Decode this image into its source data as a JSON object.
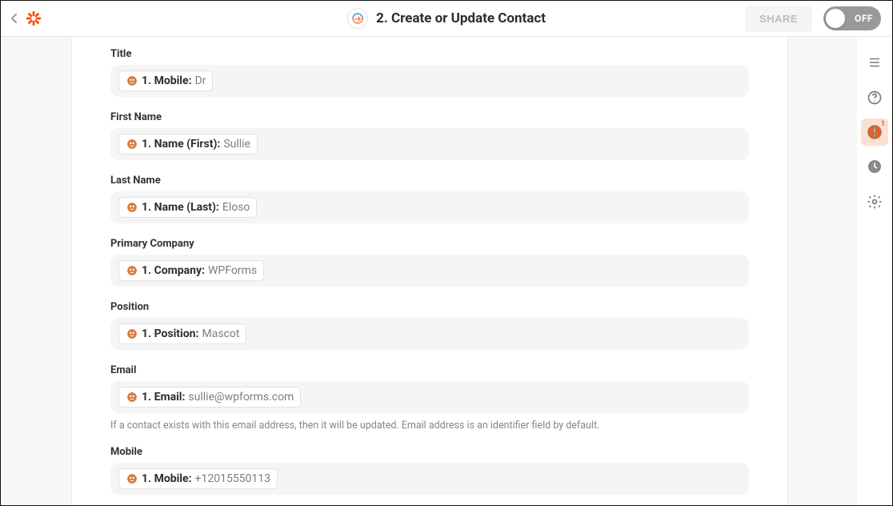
{
  "header": {
    "title": "2. Create or Update Contact",
    "share_label": "SHARE",
    "toggle_label": "OFF"
  },
  "sidebar": {
    "error_badge": "1"
  },
  "fields": [
    {
      "label": "Title",
      "pill_key": "1. Mobile:",
      "pill_value": "Dr",
      "help": ""
    },
    {
      "label": "First Name",
      "pill_key": "1. Name (First):",
      "pill_value": "Sullie",
      "help": ""
    },
    {
      "label": "Last Name",
      "pill_key": "1. Name (Last):",
      "pill_value": "Eloso",
      "help": ""
    },
    {
      "label": "Primary Company",
      "pill_key": "1. Company:",
      "pill_value": "WPForms",
      "help": ""
    },
    {
      "label": "Position",
      "pill_key": "1. Position:",
      "pill_value": "Mascot",
      "help": ""
    },
    {
      "label": "Email",
      "pill_key": "1. Email:",
      "pill_value": "sullie@wpforms.com",
      "help": "If a contact exists with this email address, then it will be updated. Email address is an identifier field by default."
    },
    {
      "label": "Mobile",
      "pill_key": "1. Mobile:",
      "pill_value": "+12015550113",
      "help": ""
    }
  ]
}
